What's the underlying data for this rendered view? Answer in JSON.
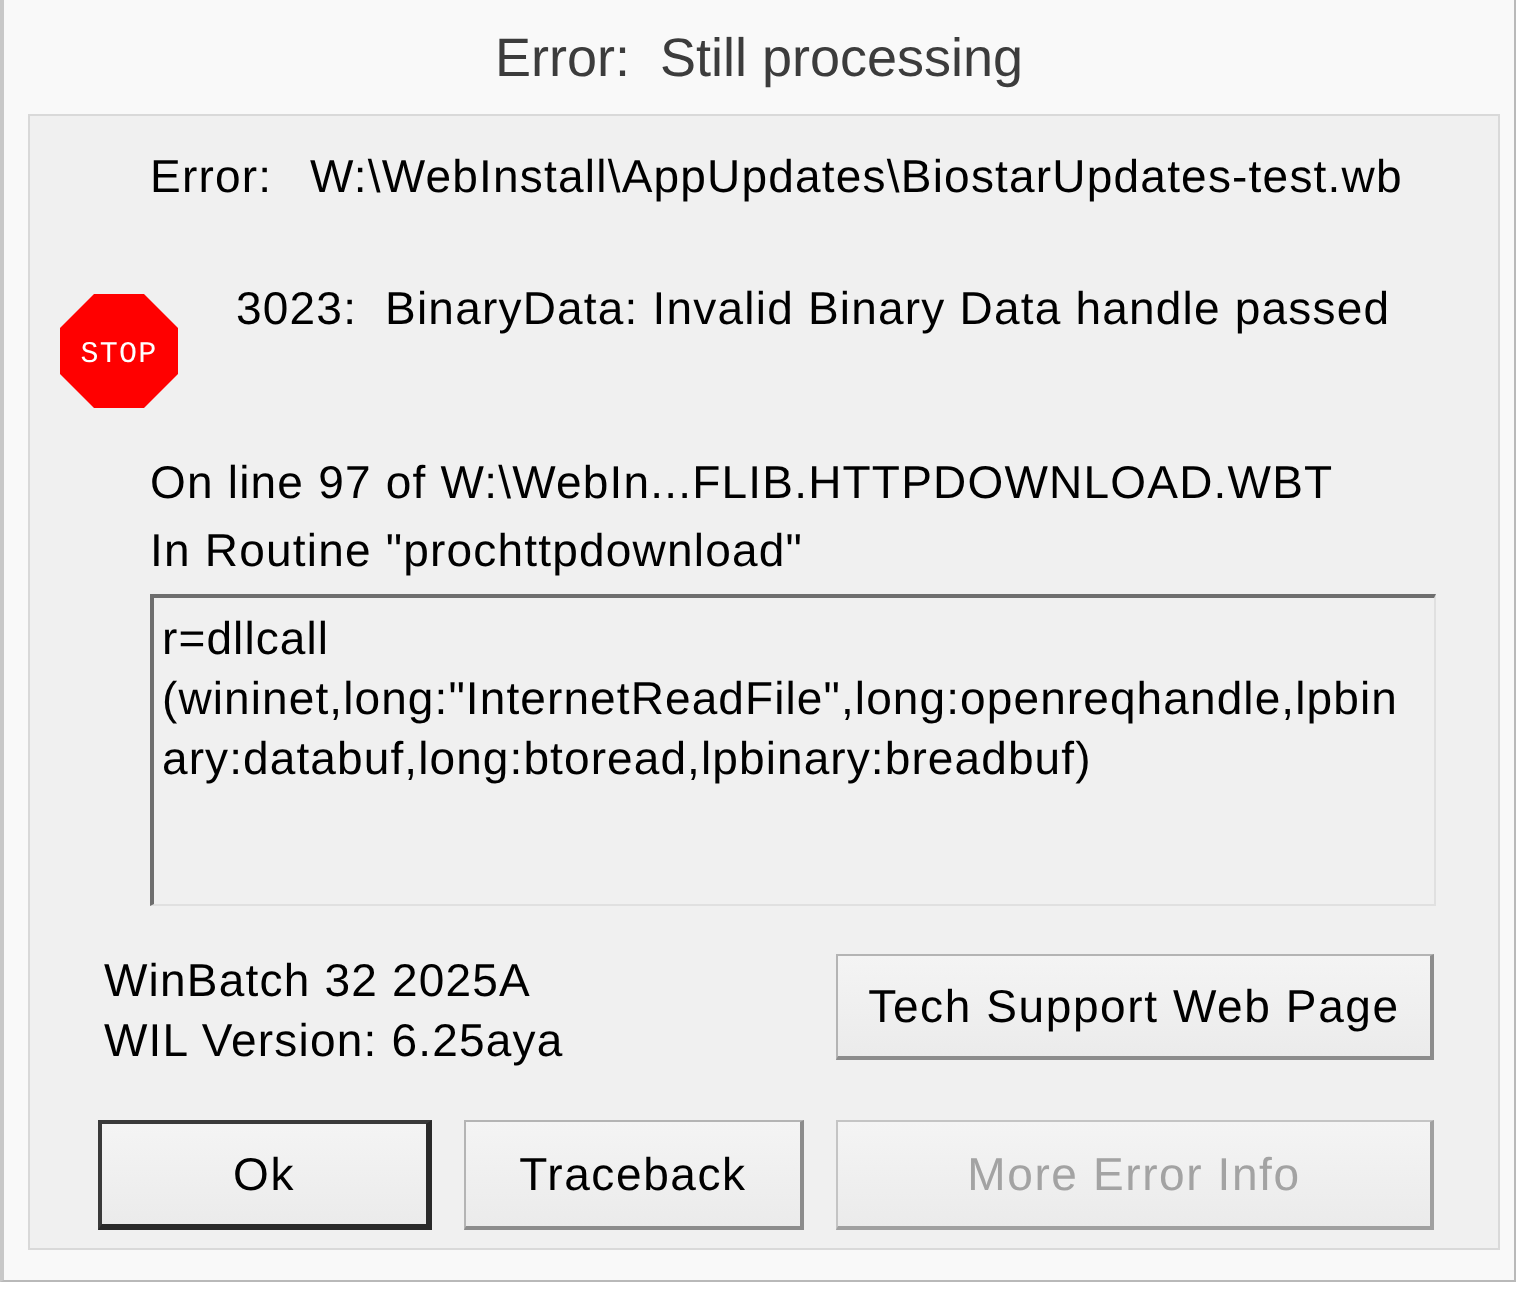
{
  "window": {
    "title": "Error:  Still processing"
  },
  "error": {
    "label": "Error:",
    "path": "W:\\WebInstall\\AppUpdates\\BiostarUpdates-test.wb"
  },
  "message": {
    "icon_text": "STOP",
    "text": "3023:  BinaryData: Invalid Binary Data handle passed"
  },
  "location": [
    "On line 97 of W:\\WebIn...FLIB.HTTPDOWNLOAD.WBT",
    "In Routine \"prochttpdownload\""
  ],
  "code_box": {
    "lines": [
      "r=dllcall",
      "(wininet,long:\"InternetReadFile\",long:openreqhandle,lpbin",
      "ary:databuf,long:btoread,lpbinary:breadbuf)"
    ]
  },
  "version": [
    "WinBatch 32 2025A",
    "WIL Version: 6.25aya"
  ],
  "support_button": {
    "label": "Tech Support Web Page",
    "disabled": false,
    "default": false
  },
  "buttons": [
    {
      "label": "Ok",
      "disabled": false,
      "default": true
    },
    {
      "label": "Traceback",
      "disabled": false,
      "default": false
    },
    {
      "label": "More Error Info",
      "disabled": true,
      "default": false
    }
  ]
}
